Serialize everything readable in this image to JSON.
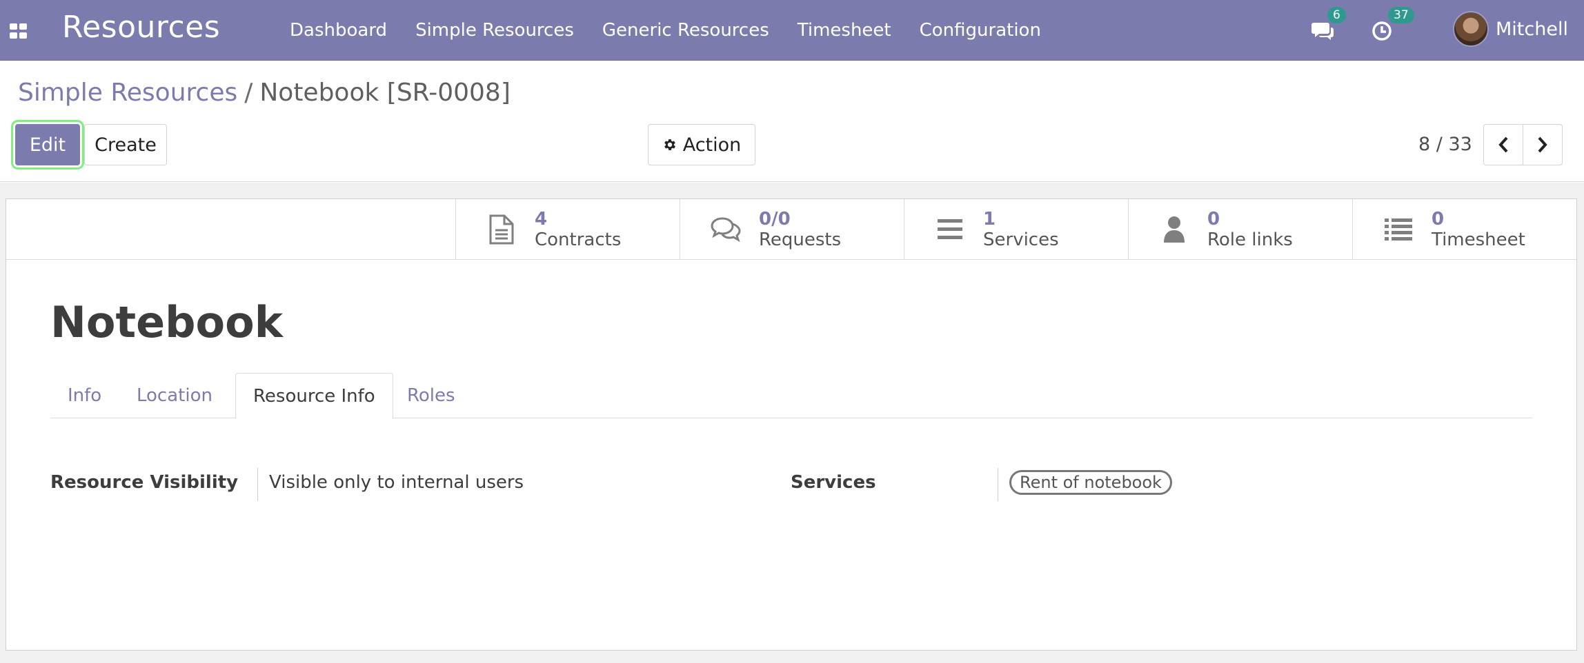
{
  "navbar": {
    "apps_icon": "grid-icon",
    "brand": "Resources",
    "menu": [
      "Dashboard",
      "Simple Resources",
      "Generic Resources",
      "Timesheet",
      "Configuration"
    ],
    "messages_count": "6",
    "activities_count": "37",
    "user_name": "Mitchell",
    "color": "#7c7bad"
  },
  "control": {
    "breadcrumb_parent": "Simple Resources",
    "breadcrumb_sep": "/",
    "breadcrumb_current": "Notebook [SR-0008]",
    "edit_label": "Edit",
    "create_label": "Create",
    "action_label": "Action",
    "pager_value": "8 / 33"
  },
  "stat_buttons": [
    {
      "value": "4",
      "label": "Contracts",
      "icon": "document-icon"
    },
    {
      "value": "0/0",
      "label": "Requests",
      "icon": "comments-icon"
    },
    {
      "value": "1",
      "label": "Services",
      "icon": "bars-icon"
    },
    {
      "value": "0",
      "label": "Role links",
      "icon": "user-icon"
    },
    {
      "value": "0",
      "label": "Timesheet",
      "icon": "list-icon"
    }
  ],
  "record": {
    "title": "Notebook",
    "tabs": [
      "Info",
      "Location",
      "Resource Info",
      "Roles"
    ],
    "active_tab": "Resource Info",
    "visibility_label": "Resource Visibility",
    "visibility_value": "Visible only to internal users",
    "services_label": "Services",
    "services_tag": "Rent of notebook"
  }
}
